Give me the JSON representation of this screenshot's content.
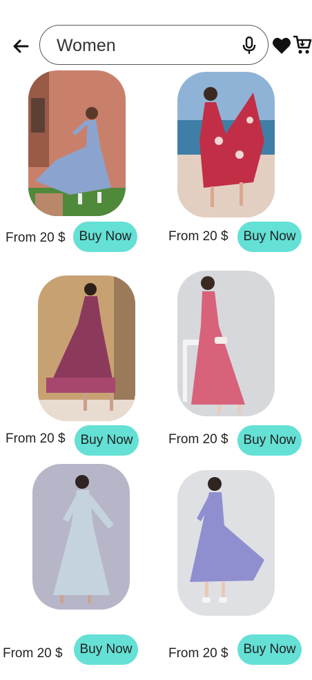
{
  "header": {
    "search_value": "Women",
    "icons": [
      "back-arrow-icon",
      "mic-icon",
      "heart-icon",
      "cart-icon"
    ]
  },
  "colors": {
    "accent": "#64e0d5",
    "border": "#555555"
  },
  "products": [
    {
      "price": "From 20 $",
      "button": "Buy Now",
      "dress_color": "#8aa4cf"
    },
    {
      "price": "From 20 $",
      "button": "Buy Now",
      "dress_color": "#c22e45"
    },
    {
      "price": "From 20 $",
      "button": "Buy Now",
      "dress_color": "#8c3a5c"
    },
    {
      "price": "From 20 $",
      "button": "Buy Now",
      "dress_color": "#d8627a"
    },
    {
      "price": "From 20 $",
      "button": "Buy Now",
      "dress_color": "#c5d3de"
    },
    {
      "price": "From 20 $",
      "button": "Buy Now",
      "dress_color": "#8f8fd0"
    }
  ]
}
